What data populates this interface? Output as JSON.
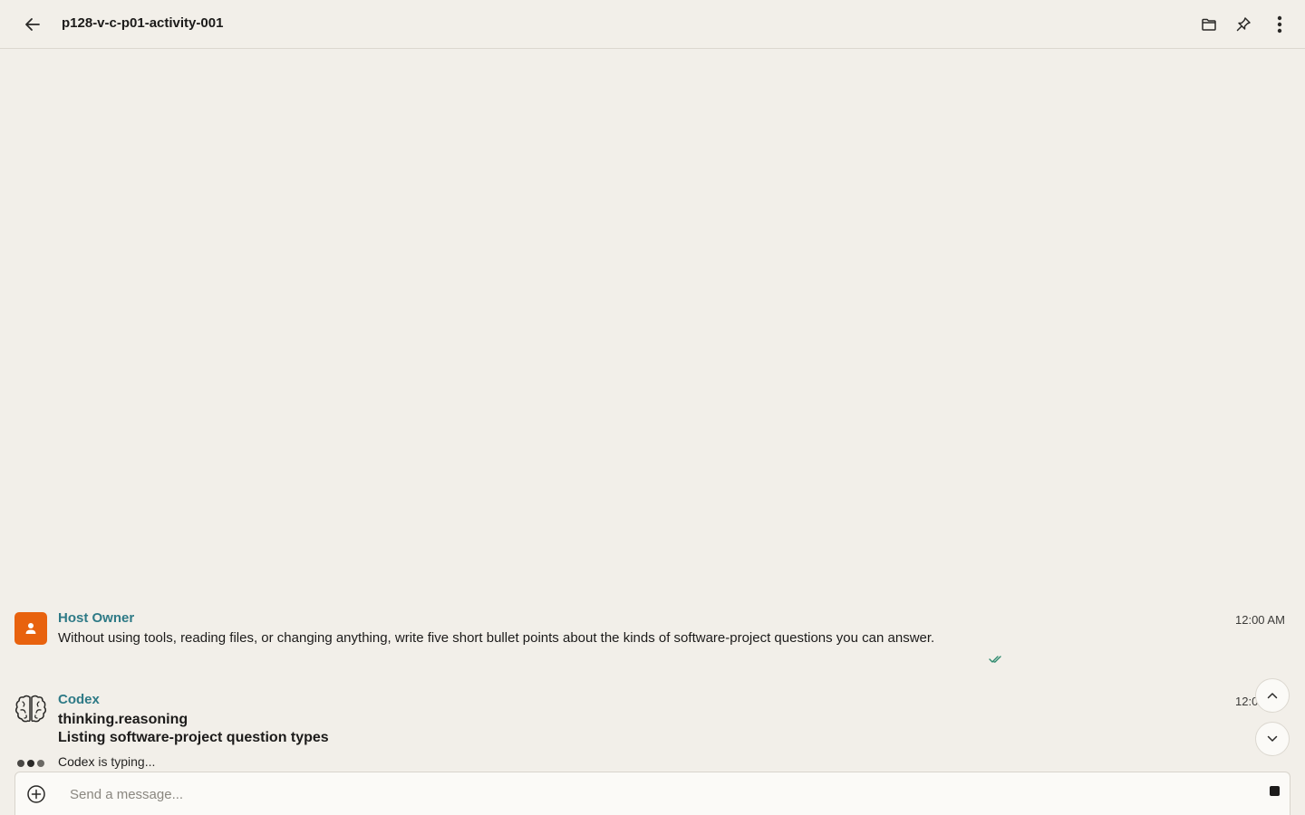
{
  "header": {
    "title": "p128-v-c-p01-activity-001",
    "icons": [
      "back-arrow-icon",
      "folder-icon",
      "pin-icon",
      "more-vertical-icon"
    ]
  },
  "messages": [
    {
      "sender": "Host Owner",
      "time": "12:00 AM",
      "text": "Without using tools, reading files, or changing anything, write five short bullet points about the kinds of software-project questions you can answer.",
      "status_icon": "double-check-icon"
    },
    {
      "sender": "Codex",
      "time": "12:0",
      "lines": [
        "thinking.reasoning",
        "Listing software-project question types"
      ]
    }
  ],
  "typing": {
    "name": "Codex",
    "suffix": " is typing..."
  },
  "composer": {
    "placeholder": "Send a message..."
  },
  "colors": {
    "background": "#f2efe9",
    "accent_owner_avatar": "#e8620e",
    "sender_name": "#2e7a86",
    "read_check": "#2e8a6e"
  }
}
